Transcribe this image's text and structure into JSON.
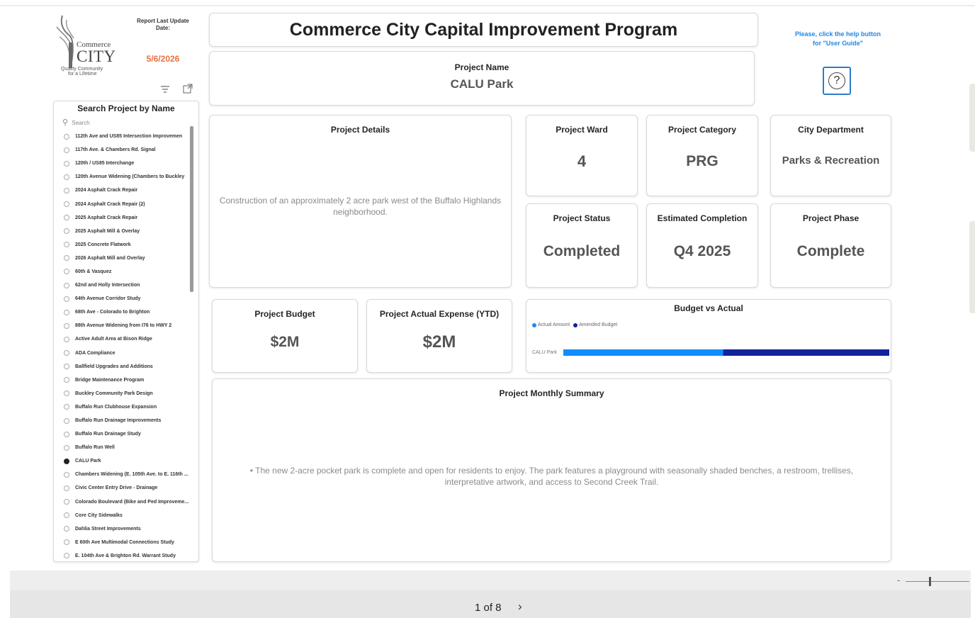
{
  "header": {
    "title": "Commerce City Capital Improvement Program",
    "update_label_line1": "Report Last Update",
    "update_label_line2": "Date:",
    "update_date": "5/6/2026",
    "help_text_line1": "Please, click the help button",
    "help_text_line2": "for \"User Guide\"",
    "help_icon": "?"
  },
  "logo": {
    "name_line1": "Commerce",
    "name_line2": "CITY",
    "tagline_line1": "Quality Community",
    "tagline_line2": "for a Lifetime"
  },
  "slicer": {
    "title": "Search Project by Name",
    "search_placeholder": "Search",
    "items": [
      "112th Ave and US85 Intersection Improvemen",
      "117th Ave. & Chambers Rd. Signal",
      "120th / US85 Interchange",
      "120th Avenue Widening (Chambers to Buckley",
      "2024 Asphalt Crack Repair",
      "2024 Asphalt Crack Repair (2)",
      "2025 Asphalt Crack Repair",
      "2025 Asphalt Mill & Overlay",
      "2025 Concrete Flatwork",
      "2026 Asphalt Mill and Overlay",
      "60th & Vasquez",
      "62nd and Holly Intersection",
      "64th Avenue Corridor Study",
      "68th Ave - Colorado to Brighton",
      "88th Avenue Widening from I76 to HWY 2",
      "Active Adult Area at Bison Ridge",
      "ADA Compliance",
      "Ballfield Upgrades and Additions",
      "Bridge Maintenance Program",
      "Buckley Community Park Design",
      "Buffalo Run Clubhouse Expansion",
      "Buffalo Run Drainage Improvements",
      "Buffalo Run Drainage Study",
      "Buffalo Run Well",
      "CALU Park",
      "Chambers Widening (E. 105th Ave. to E. 116th ...",
      "Civic Center Entry Drive - Drainage",
      "Colorado Boulevard (Bike and Ped Improveme...",
      "Core City Sidewalks",
      "Dahlia Street Improvements",
      "E 60th Ave Multimodal Connections Study",
      "E. 104th Ave & Brighton Rd. Warrant Study"
    ],
    "selected": "CALU Park"
  },
  "project": {
    "name_label": "Project Name",
    "name": "CALU Park",
    "details_label": "Project Details",
    "details": "Construction of an approximately 2 acre park west of the Buffalo Highlands neighborhood.",
    "ward_label": "Project Ward",
    "ward": "4",
    "category_label": "Project Category",
    "category": "PRG",
    "department_label": "City Department",
    "department": "Parks & Recreation",
    "status_label": "Project Status",
    "status": "Completed",
    "completion_label": "Estimated Completion",
    "completion": "Q4 2025",
    "phase_label": "Project Phase",
    "phase": "Complete",
    "budget_label": "Project Budget",
    "budget": "$2M",
    "expense_label": "Project Actual Expense (YTD)",
    "expense": "$2M",
    "summary_label": "Project Monthly Summary",
    "summary": "• The new 2-acre pocket park is complete and open for residents to enjoy. The park features a playground with seasonally shaded benches, a restroom, trellises, interpretative  artwork, and access to Second Creek Trail."
  },
  "chart_data": {
    "type": "bar",
    "title": "Budget vs Actual",
    "categories": [
      "CALU Park"
    ],
    "series": [
      {
        "name": "Actual Amount",
        "color": "#118dff",
        "values": [
          0.49
        ]
      },
      {
        "name": "Amended Budget",
        "color": "#12239e",
        "values": [
          0.51
        ]
      }
    ],
    "legend_position": "top-left",
    "orientation": "horizontal-stacked"
  },
  "footer": {
    "page_indicator": "1 of 8",
    "next_icon": "›",
    "zoom_minus": "-"
  }
}
